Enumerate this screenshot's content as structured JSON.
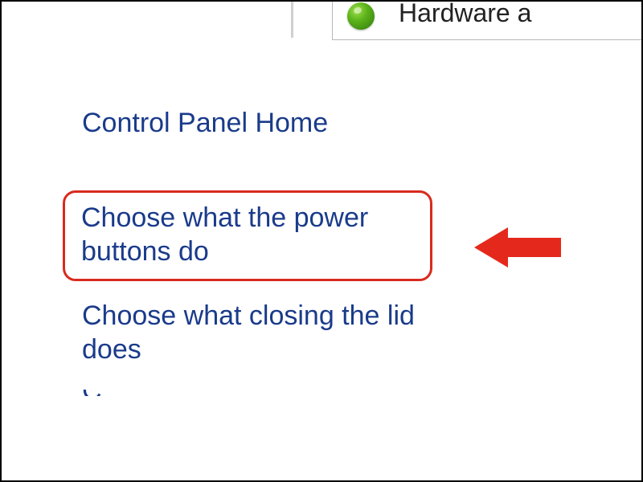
{
  "topBox": {
    "partialLabel": "Hardware a"
  },
  "sidebar": {
    "homeLink": "Control Panel Home",
    "link1": "Choose what the power buttons do",
    "link2": "Choose what closing the lid does",
    "link3_partial": "C"
  },
  "colors": {
    "linkBlue": "#1a3b8b",
    "highlightRed": "#d92a1e",
    "arrowRed": "#e4291c"
  }
}
